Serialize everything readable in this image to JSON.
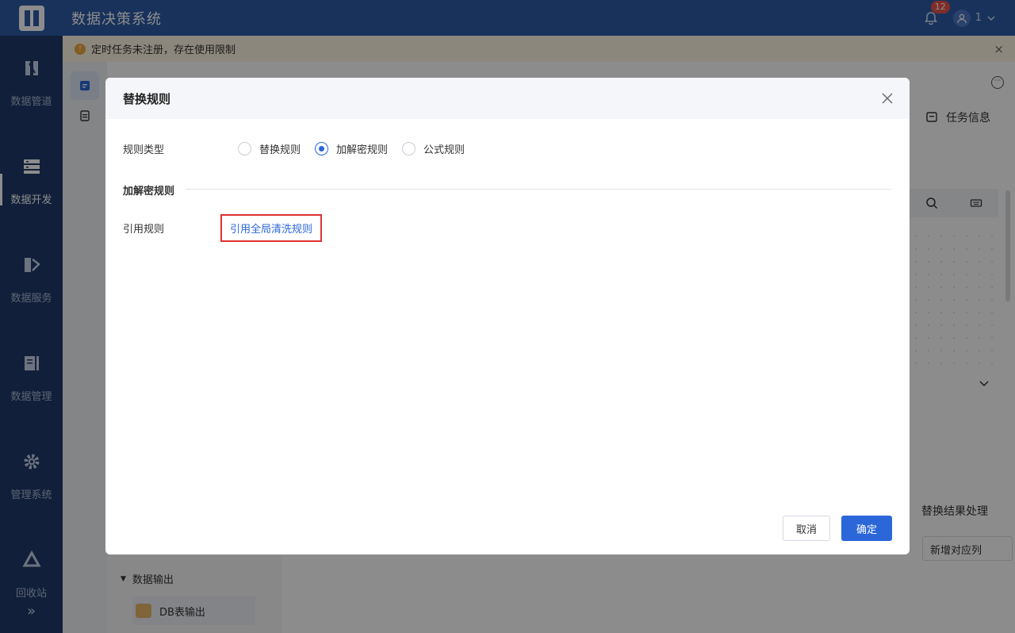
{
  "app": {
    "title": "数据决策系统"
  },
  "header": {
    "notification_count": "12",
    "user_name": "1"
  },
  "sidebar": {
    "items": [
      {
        "label": "数据管道",
        "icon": "pipeline-icon"
      },
      {
        "label": "数据开发",
        "icon": "data-dev-icon",
        "active": true
      },
      {
        "label": "数据服务",
        "icon": "data-service-icon"
      },
      {
        "label": "数据管理",
        "icon": "data-manage-icon"
      },
      {
        "label": "管理系统",
        "icon": "gear-icon"
      },
      {
        "label": "回收站",
        "icon": "recycle-icon"
      }
    ],
    "expand_label": "»"
  },
  "notice": {
    "text": "定时任务未注册，存在使用限制",
    "close_label": "×"
  },
  "background": {
    "task_info": "任务信息",
    "replace_result": "替换结果处理",
    "add_column": "新增对应列",
    "data_output": "数据输出",
    "db_output": "DB表输出"
  },
  "modal": {
    "title": "替换规则",
    "rule_type_label": "规则类型",
    "rule_types": [
      {
        "label": "替换规则",
        "checked": false
      },
      {
        "label": "加解密规则",
        "checked": true
      },
      {
        "label": "公式规则",
        "checked": false
      }
    ],
    "section_title": "加解密规则",
    "reference_label": "引用规则",
    "reference_link": "引用全局清洗规则",
    "cancel_label": "取消",
    "ok_label": "确定"
  },
  "colors": {
    "header": "#2d5ba8",
    "sidebar": "#1f3a6a",
    "primary": "#2b67d8",
    "highlight": "#e03030"
  }
}
